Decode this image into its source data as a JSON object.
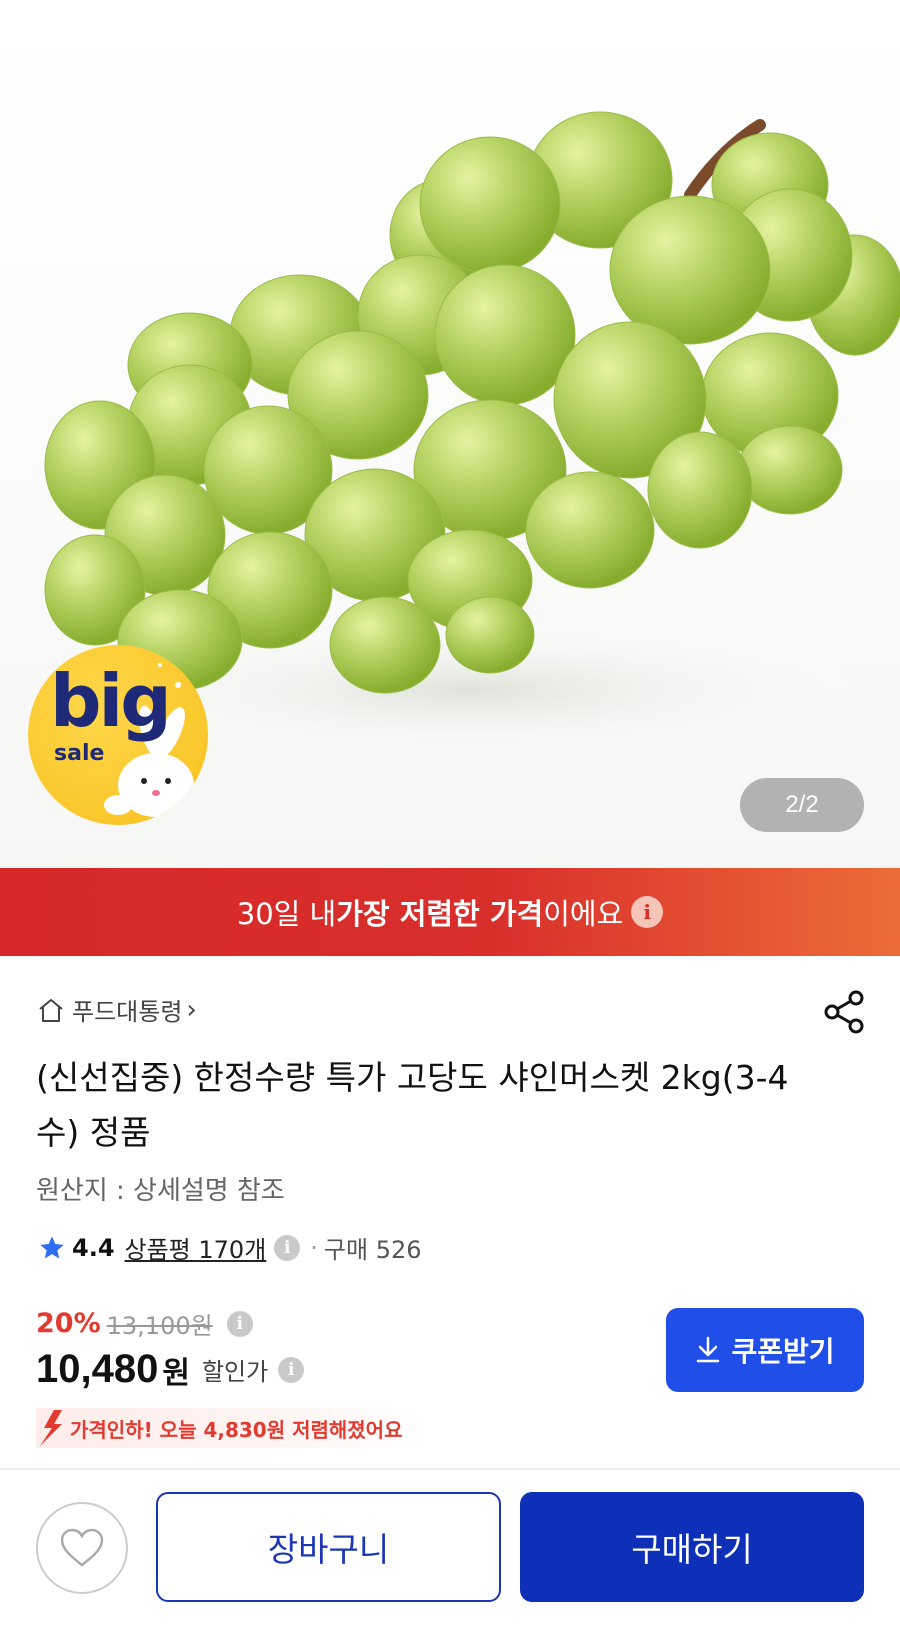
{
  "gallery": {
    "pager_text": "2/2",
    "badge_big": "big",
    "badge_sale": "sale"
  },
  "banner": {
    "prefix": "30일 내 ",
    "highlight": "가장 저렴한 가격",
    "suffix": "이에요",
    "info_symbol": "i"
  },
  "product": {
    "store_name": "푸드대통령",
    "store_chevron": "›",
    "title": "(신선집중) 한정수량 특가 고당도 샤인머스켓 2kg(3-4수) 정품",
    "origin": "원산지 : 상세설명 참조",
    "rating": "4.4",
    "review_label": "상품평 170개",
    "dot": "·",
    "purchase_label": "구매 526"
  },
  "price": {
    "discount_rate": "20%",
    "original_price": "13,100원",
    "sale_price": "10,480",
    "currency": "원",
    "sale_label": "할인가",
    "coupon_label": "쿠폰받기",
    "price_drop_text": "가격인하! 오늘 4,830원 저렴해졌어요"
  },
  "actions": {
    "cart_label": "장바구니",
    "buy_label": "구매하기"
  },
  "colors": {
    "banner_red": "#d92f2b",
    "coupon_blue": "#1f4fe8",
    "buy_navy": "#0e2fb8",
    "discount_red": "#e23a2f"
  }
}
